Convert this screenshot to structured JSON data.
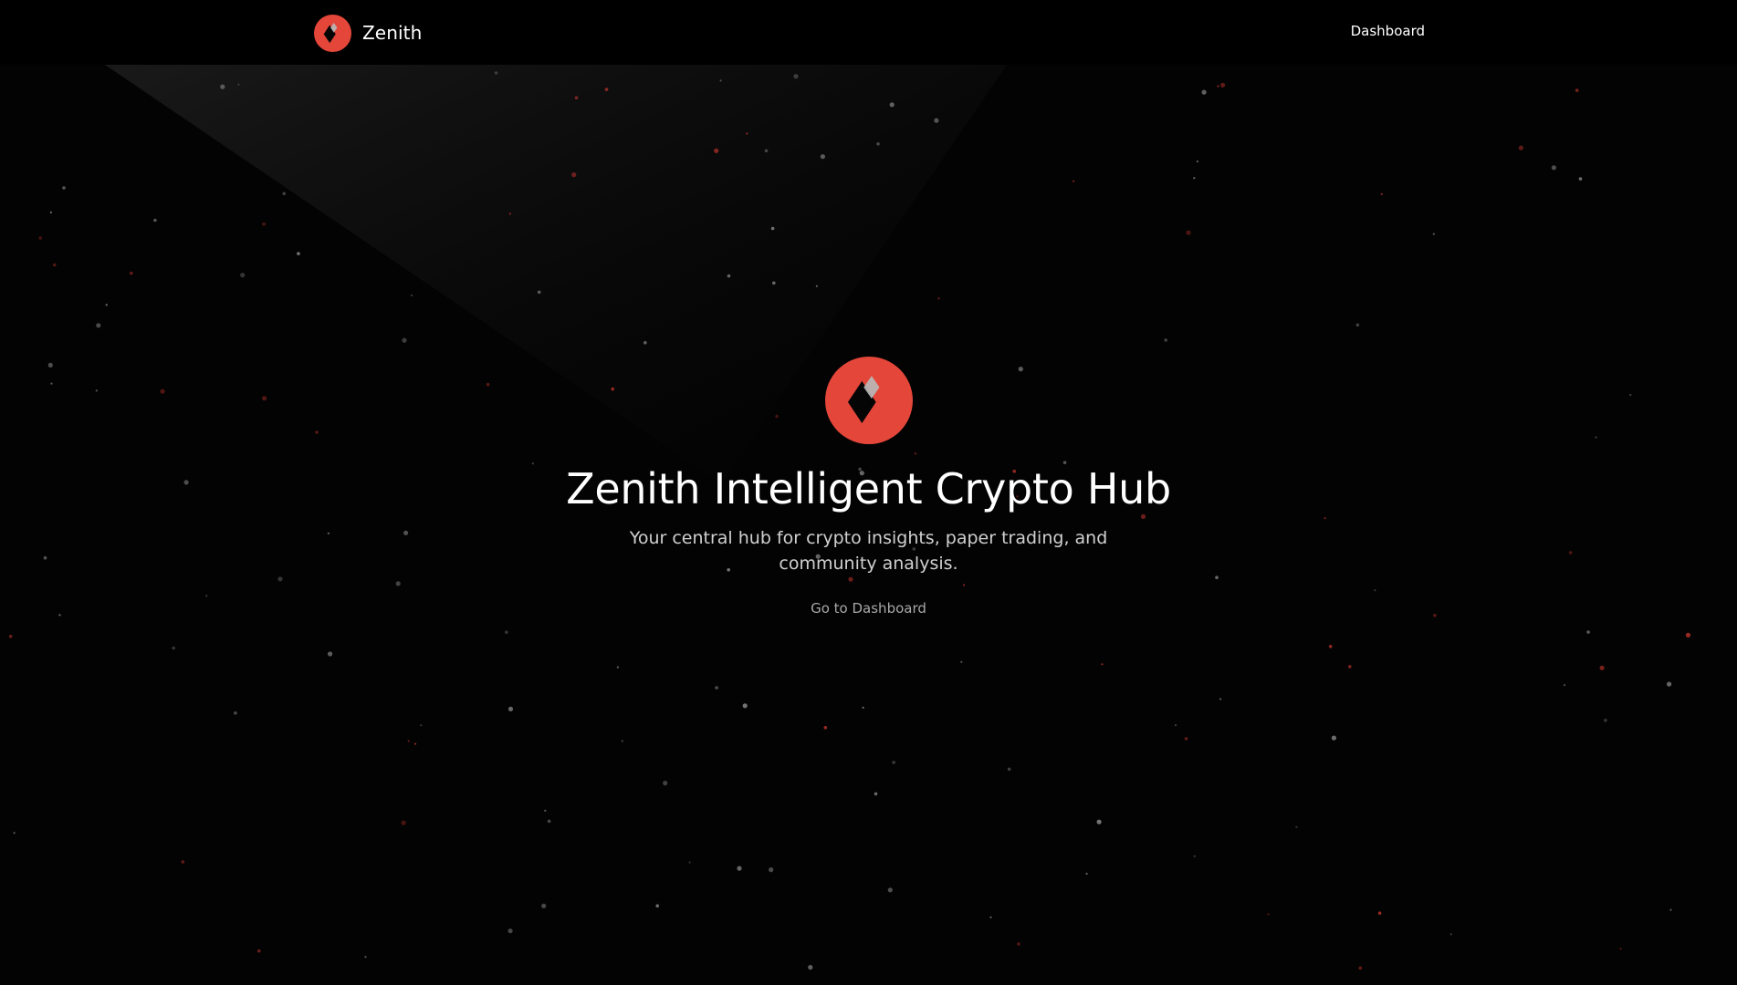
{
  "colors": {
    "background": "#030303",
    "navbar": "#000000",
    "brand_red": "#E5463A",
    "text_primary": "#FFFFFF",
    "text_secondary": "#D0D0D0",
    "text_muted": "#A8A8A8"
  },
  "navbar": {
    "brand_name": "Zenith",
    "brand_icon": "zenith-diamond-logo-icon",
    "links": [
      {
        "label": "Dashboard"
      }
    ]
  },
  "hero": {
    "icon": "zenith-diamond-logo-icon",
    "title": "Zenith Intelligent Crypto Hub",
    "subtitle": "Your central hub for crypto insights, paper trading, and community analysis.",
    "cta_label": "Go to Dashboard"
  }
}
